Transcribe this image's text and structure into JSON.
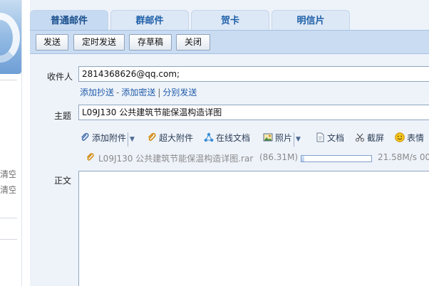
{
  "sidebar": {
    "clear_label_1": "清空]",
    "clear_label_2": "清空]"
  },
  "tabs": [
    {
      "label": "普通邮件",
      "active": true
    },
    {
      "label": "群邮件",
      "active": false
    },
    {
      "label": "贺卡",
      "active": false
    },
    {
      "label": "明信片",
      "active": false
    }
  ],
  "toolbar": {
    "send": "发送",
    "scheduled_send": "定时发送",
    "save_draft": "存草稿",
    "close": "关闭"
  },
  "form": {
    "recipient_label": "收件人",
    "recipient_value": "2814368626@qq.com;",
    "add_cc": "添加抄送",
    "add_bcc": "添加密送",
    "separate_send": "分别发送",
    "link_sep_1": "-",
    "link_sep_2": "|",
    "subject_label": "主题",
    "subject_value": "L09J130 公共建筑节能保温构造详图",
    "body_label": "正文",
    "body_value": ""
  },
  "attach_bar": {
    "add_attachment": "添加附件",
    "large_attachment": "超大附件",
    "online_doc": "在线文档",
    "photo": "照片",
    "document": "文档",
    "screenshot": "截屏",
    "emoticon": "表情"
  },
  "upload": {
    "file_name": "L09J130 公共建筑节能保温构造详图.rar",
    "file_size": "(86.31M)",
    "speed": "21.58M/s 00",
    "progress_fraction": 0.04
  },
  "colors": {
    "link": "#1e5aa8",
    "tab_text": "#1d5fa8",
    "toolbar_bg": "#c9dcf2",
    "main_bg": "#eef3fa"
  },
  "icons": {
    "attachment": "paperclip-icon",
    "large_attachment": "paperclip-icon",
    "online_doc": "share-nodes-icon",
    "photo": "photo-icon",
    "document": "document-icon",
    "screenshot": "scissors-icon",
    "emoticon": "smiley-icon"
  }
}
